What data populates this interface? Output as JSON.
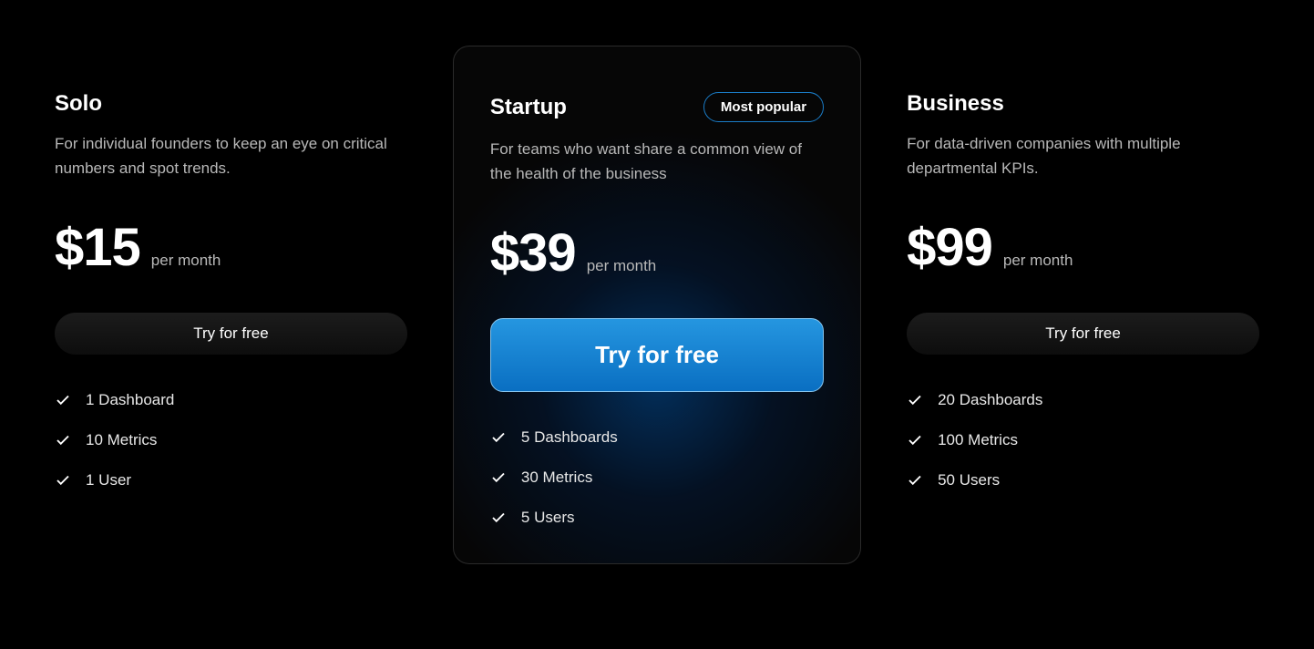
{
  "plans": [
    {
      "id": "solo",
      "name": "Solo",
      "description": "For individual founders to keep an eye on critical numbers and spot trends.",
      "price": "$15",
      "period": "per month",
      "cta": "Try for free",
      "featured": false,
      "features": [
        "1 Dashboard",
        "10 Metrics",
        "1 User"
      ]
    },
    {
      "id": "startup",
      "name": "Startup",
      "badge": "Most popular",
      "description": "For teams who want share a common view of the health of the business",
      "price": "$39",
      "period": "per month",
      "cta": "Try for free",
      "featured": true,
      "features": [
        "5 Dashboards",
        "30 Metrics",
        "5 Users"
      ]
    },
    {
      "id": "business",
      "name": "Business",
      "description": "For data-driven companies with multiple departmental KPIs.",
      "price": "$99",
      "period": "per month",
      "cta": "Try for free",
      "featured": false,
      "features": [
        "20 Dashboards",
        "100 Metrics",
        "50 Users"
      ]
    }
  ]
}
